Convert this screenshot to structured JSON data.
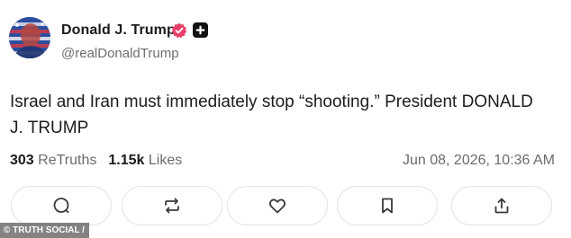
{
  "author": {
    "display_name": "Donald J. Trump",
    "handle": "@realDonaldTrump",
    "verified": true
  },
  "post": {
    "text": "Israel and Iran must immediately stop “shooting.” President DONALD J. TRUMP",
    "retruths_count": "303",
    "retruths_label": "ReTruths",
    "likes_count": "1.15k",
    "likes_label": "Likes",
    "timestamp": "Jun 08, 2026, 10:36 AM"
  },
  "actions": [
    {
      "name": "reply",
      "icon": "comment-icon"
    },
    {
      "name": "retruth",
      "icon": "repost-icon"
    },
    {
      "name": "like",
      "icon": "heart-icon"
    },
    {
      "name": "bookmark",
      "icon": "bookmark-icon"
    },
    {
      "name": "share",
      "icon": "share-icon"
    }
  ],
  "watermark": "© TRUTH SOCIAL /",
  "colors": {
    "verified_badge": "#e9416a",
    "text_primary": "#1c1c1c",
    "text_secondary": "#6b6b6b",
    "button_border": "#e2e2e2",
    "icon": "#3a3a3a"
  }
}
